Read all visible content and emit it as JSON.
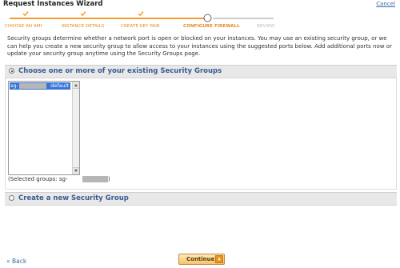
{
  "window": {
    "title": "Request Instances Wizard",
    "cancel_label": "Cancel"
  },
  "wizard": {
    "steps": [
      {
        "label": "CHOOSE AN AMI",
        "state": "completed"
      },
      {
        "label": "INSTANCE DETAILS",
        "state": "completed"
      },
      {
        "label": "CREATE KEY PAIR",
        "state": "completed"
      },
      {
        "label": "CONFIGURE FIREWALL",
        "state": "current"
      },
      {
        "label": "REVIEW",
        "state": "upcoming"
      }
    ],
    "colors": {
      "completed": "#f39c2b",
      "upcoming": "#cccccc",
      "label_completed": "#e08a1e",
      "label_upcoming": "#bbbbbb"
    }
  },
  "intro": {
    "text": "Security groups determine whether a network port is open or blocked on your instances. You may use an existing security group, or we can help you create a new security group to allow access to your instances using the suggested ports below. Add additional ports now or update your security group anytime using the Security Groups page."
  },
  "existing": {
    "label": "Choose one or more of your existing Security Groups",
    "selected": true,
    "groups": [
      {
        "id": "sg-",
        "name": "default"
      }
    ],
    "selected_groups_text": "(Selected groups: sg-",
    "selected_groups_close": ")"
  },
  "create_new": {
    "label": "Create a new Security Group",
    "selected": false
  },
  "footer": {
    "back_label": "« Back",
    "continue_label": "Continue"
  }
}
